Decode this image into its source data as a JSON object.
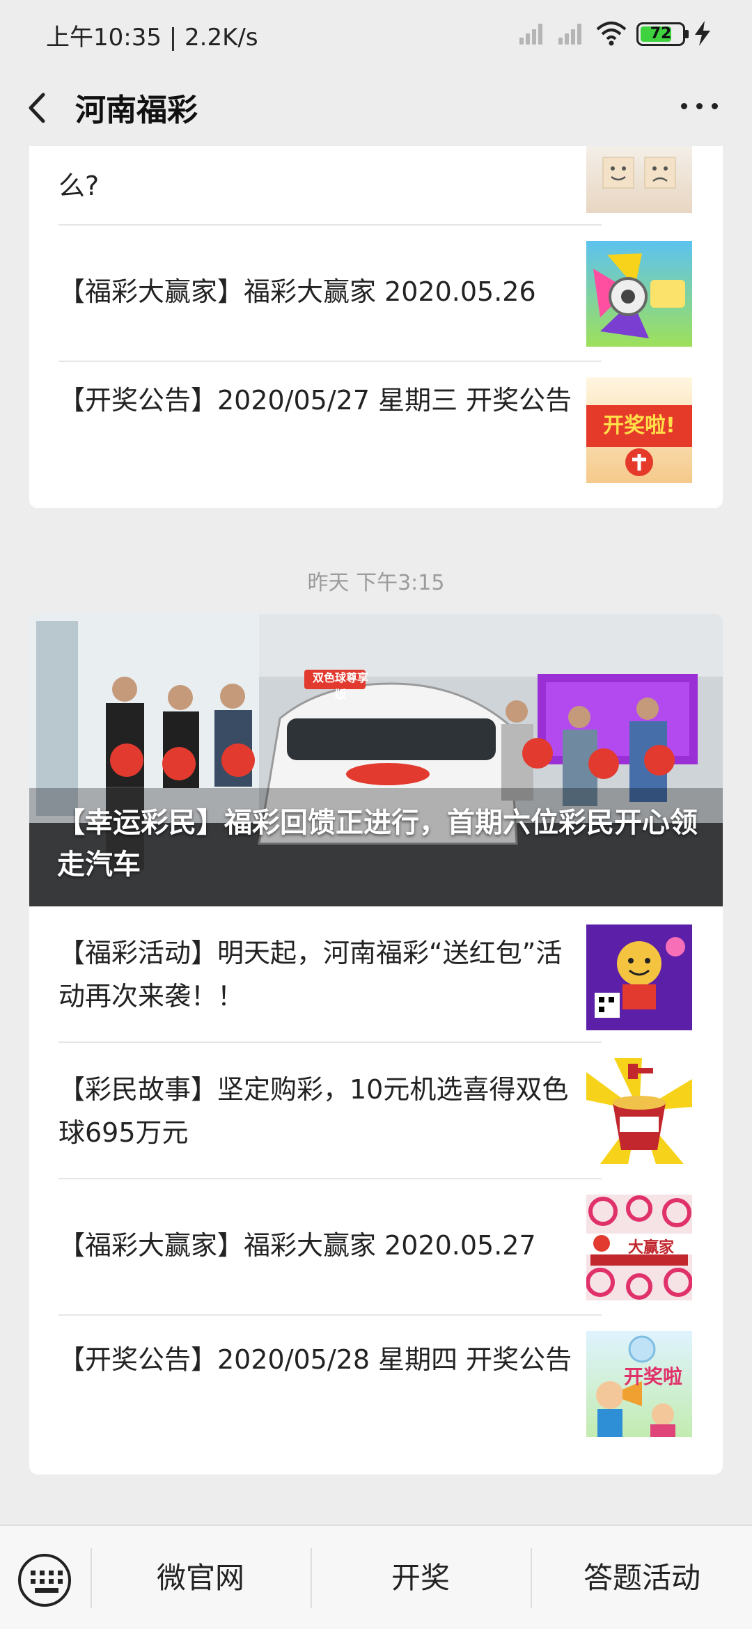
{
  "status_bar": {
    "time_speed": "上午10:35 | 2.2K/s",
    "battery": "72",
    "icons": [
      "cellular-signal-icon",
      "cellular-signal-icon",
      "wifi-icon",
      "battery-icon",
      "charging-bolt-icon"
    ]
  },
  "nav": {
    "title": "河南福彩",
    "back_icon": "chevron-left-icon",
    "more_icon": "more-dots-icon"
  },
  "group1": {
    "items": [
      {
        "title": "么?",
        "thumb": "smiley-faces-blocks"
      },
      {
        "title": "【福彩大赢家】福彩大赢家 2020.05.26",
        "thumb": "colorful-loudspeaker"
      },
      {
        "title": "【开奖公告】2020/05/27 星期三 开奖公告",
        "thumb": "kaijiang-banner"
      }
    ],
    "thumb_text": {
      "kaijiang": "开奖啦!"
    }
  },
  "timestamp": "昨天 下午3:15",
  "group2": {
    "hero_title": "【幸运彩民】福彩回馈正进行，首期六位彩民开心领走汽车",
    "hero_banner": "双色球尊享版",
    "items": [
      {
        "title": "【福彩活动】明天起，河南福彩“送红包”活动再次来袭！！",
        "thumb": "purple-red-envelope-poster"
      },
      {
        "title": "【彩民故事】坚定购彩，10元机选喜得双色球695万元",
        "thumb": "red-bucket-coins"
      },
      {
        "title": "【福彩大赢家】福彩大赢家 2020.05.27",
        "thumb": "radio-da-ying-jia"
      },
      {
        "title": "【开奖公告】2020/05/28 星期四 开奖公告",
        "thumb": "kaijiang-cartoon"
      }
    ],
    "thumb_text": {
      "dayingjia": "大赢家",
      "kaijiang": "开奖啦"
    }
  },
  "bottom_menu": {
    "keyboard_icon": "keyboard-icon",
    "items": [
      "微官网",
      "开奖",
      "答题活动"
    ]
  },
  "colors": {
    "page_bg": "#ededed",
    "card_bg": "#ffffff",
    "text": "#222222",
    "muted": "#9b9b9b",
    "brand_red": "#e03a2e"
  }
}
